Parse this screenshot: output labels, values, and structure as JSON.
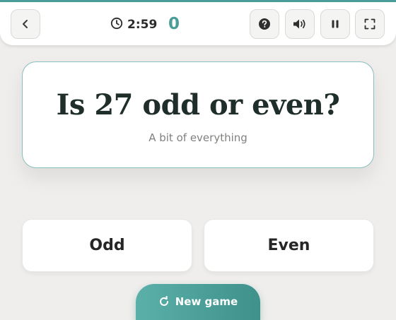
{
  "header": {
    "timer": "2:59",
    "score": "0"
  },
  "question": {
    "text": "Is 27 odd or even?",
    "subtitle": "A bit of everything"
  },
  "answers": [
    {
      "label": "Odd"
    },
    {
      "label": "Even"
    }
  ],
  "new_game": {
    "label": "New game"
  },
  "icons": {
    "back": "chevron-left-icon",
    "timer": "clock-icon",
    "help": "question-circle-icon",
    "sound": "speaker-icon",
    "pause": "pause-icon",
    "fullscreen": "fullscreen-icon",
    "new_game": "refresh-icon"
  },
  "colors": {
    "accent": "#4a9d98",
    "background": "#efeeec",
    "question_text": "#1f2e2b"
  }
}
